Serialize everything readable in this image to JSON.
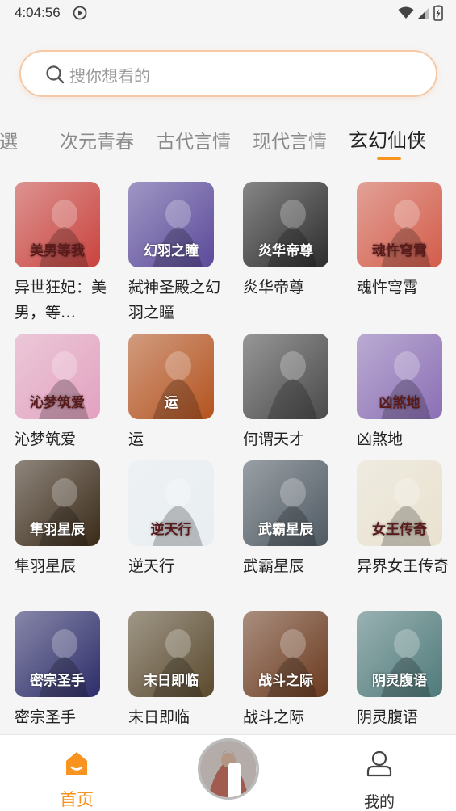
{
  "status_bar": {
    "time": "4:04:56"
  },
  "search": {
    "placeholder": "搜你想看的"
  },
  "tabs": [
    {
      "label": "都市热选",
      "shown": "選"
    },
    {
      "label": "次元青春"
    },
    {
      "label": "古代言情"
    },
    {
      "label": "现代言情"
    },
    {
      "label": "玄幻仙侠",
      "active": true
    }
  ],
  "books": [
    {
      "title": "异世狂妃：美男，等…",
      "cover_text": "美男等我",
      "theme": "#c9433e"
    },
    {
      "title": "弑神圣殿之幻羽之瞳",
      "cover_text": "幻羽之瞳",
      "theme": "#5b4a9b"
    },
    {
      "title": "炎华帝尊",
      "cover_text": "炎华帝尊",
      "theme": "#2c2c2c"
    },
    {
      "title": "魂忤穹霄",
      "cover_text": "魂忤穹霄",
      "theme": "#d35c4a"
    },
    {
      "title": "沁梦筑爱",
      "cover_text": "沁梦筑爱",
      "theme": "#e3a2c0"
    },
    {
      "title": "运",
      "cover_text": "运",
      "theme": "#b4531f"
    },
    {
      "title": "何谓天才",
      "cover_text": "",
      "theme": "#4a4a4a"
    },
    {
      "title": "凶煞地",
      "cover_text": "凶煞地",
      "theme": "#8b6fb5"
    },
    {
      "title": "隼羽星辰",
      "cover_text": "隼羽星辰",
      "theme": "#3a2a18"
    },
    {
      "title": "逆天行",
      "cover_text": "逆天行",
      "theme": "#e8eef2"
    },
    {
      "title": "武霸星辰",
      "cover_text": "武霸星辰",
      "theme": "#4f5a63"
    },
    {
      "title": "异界女王传奇",
      "cover_text": "女王传奇",
      "theme": "#e9e2cf"
    },
    {
      "title": "密宗圣手",
      "cover_text": "密宗圣手",
      "theme": "#2d2d6a"
    },
    {
      "title": "末日即临",
      "cover_text": "末日即临",
      "theme": "#5a4a2e"
    },
    {
      "title": "战斗之际",
      "cover_text": "战斗之际",
      "theme": "#6b3a1e"
    },
    {
      "title": "阴灵腹语",
      "cover_text": "阴灵腹语",
      "theme": "#4f7a7a"
    }
  ],
  "bottom_nav": {
    "home_label": "首页",
    "mine_label": "我的"
  },
  "colors": {
    "accent": "#f7931e",
    "search_border": "#f6c9a6"
  },
  "icons": [
    "play-circle-icon",
    "wifi-icon",
    "signal-icon",
    "battery-icon",
    "search-icon",
    "home-icon",
    "user-icon",
    "pause-icon"
  ]
}
